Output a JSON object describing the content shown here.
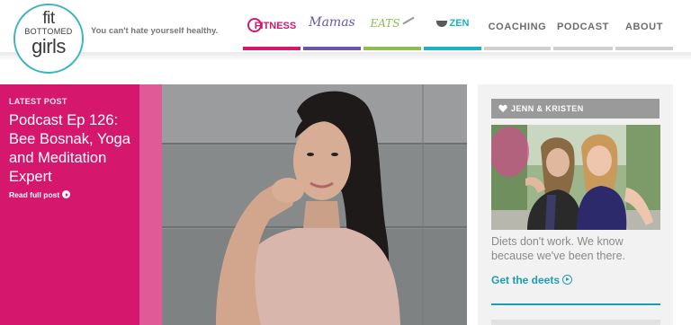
{
  "header": {
    "logo": {
      "line1": "fit",
      "line2": "BOTTOMED",
      "line3": "girls"
    },
    "tagline": "You can't hate yourself healthy.",
    "nav": [
      {
        "label": "FITNESS",
        "color": "#d6176e"
      },
      {
        "label": "Mamas",
        "color": "#6a56a6"
      },
      {
        "label": "EATS",
        "color": "#8cc04b"
      },
      {
        "label": "ZEN",
        "color": "#1cb2c3"
      },
      {
        "label": "COACHING",
        "color": "#cfcfcf"
      },
      {
        "label": "PODCAST",
        "color": "#cfcfcf"
      },
      {
        "label": "ABOUT",
        "color": "#cfcfcf"
      }
    ]
  },
  "hero": {
    "kicker": "LATEST POST",
    "title": "Podcast Ep 126: Bee Bosnak, Yoga and Meditation Expert",
    "cta": "Read full post",
    "accent": "#d6176e"
  },
  "sidebar": {
    "tag": "JENN & KRISTEN",
    "text": "Diets don't work. We know because we've been there.",
    "link": "Get the deets",
    "link_color": "#1a9fb2"
  }
}
